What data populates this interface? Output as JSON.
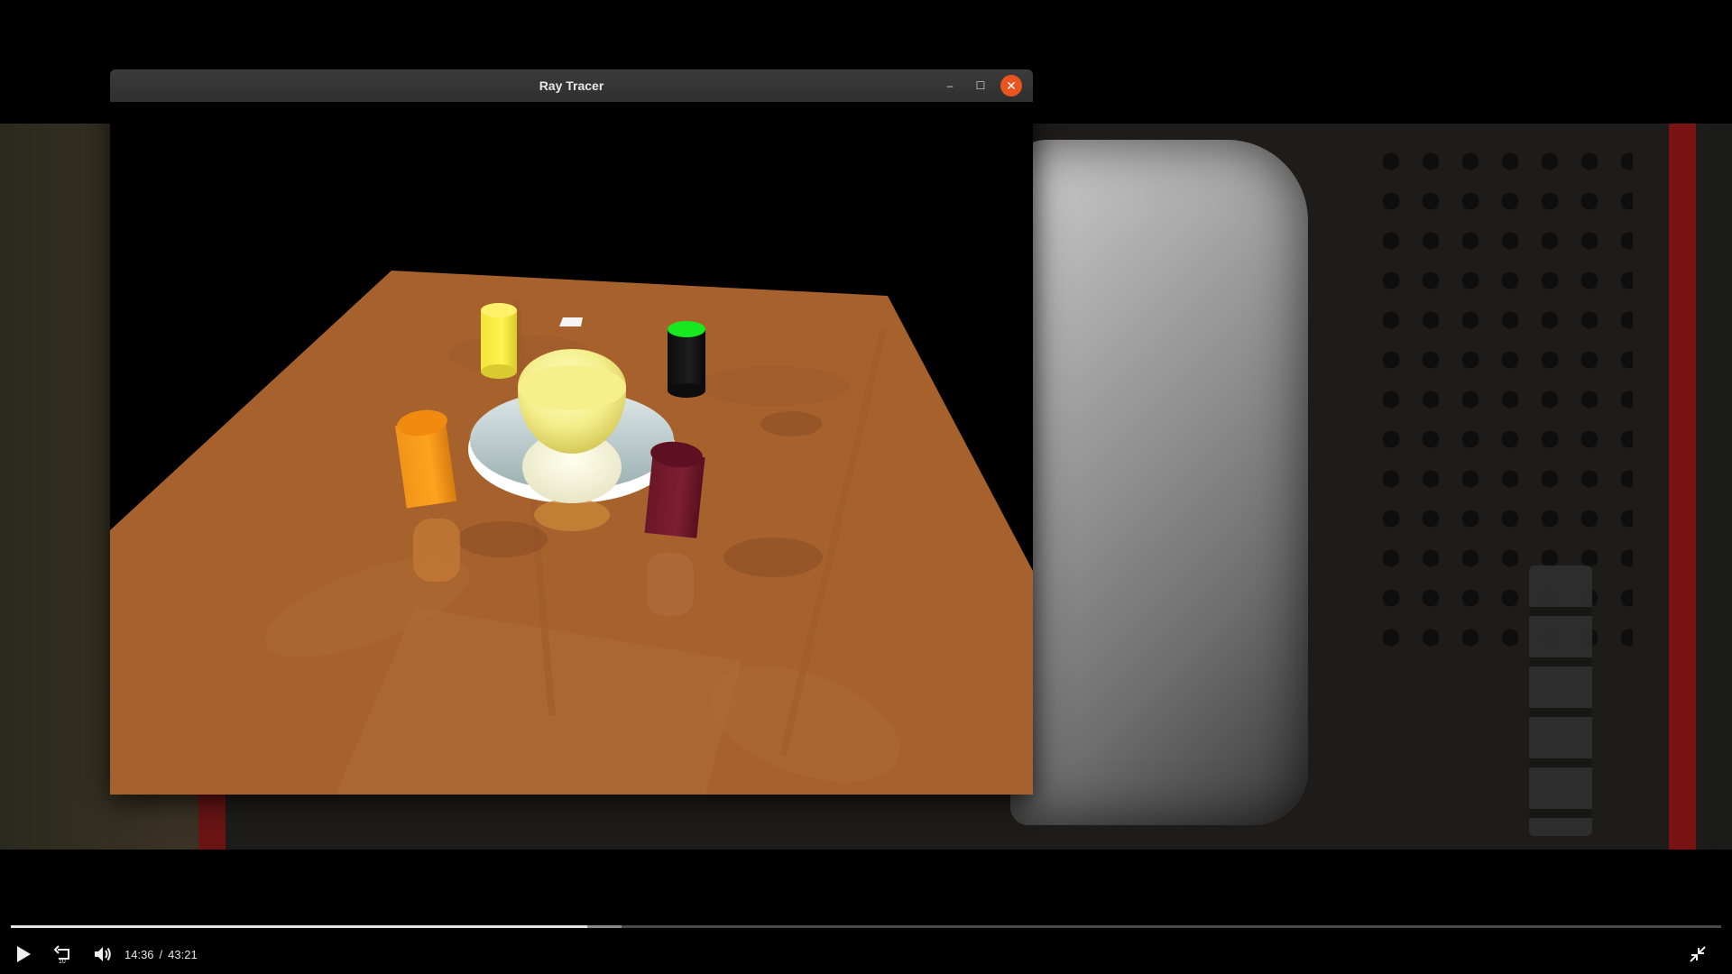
{
  "window": {
    "title": "Ray Tracer",
    "controls": {
      "minimize": "–",
      "maximize": "☐",
      "close": "✕"
    }
  },
  "player": {
    "current_time": "14:36",
    "separator": "/",
    "duration": "43:21",
    "progress": 0.337,
    "buffered": 0.357,
    "icons": [
      "play-icon",
      "replay-10-icon",
      "volume-icon",
      "fullscreen-exit-icon"
    ]
  },
  "colors": {
    "table": "#a6612d",
    "title_bar": "#2f2f2f",
    "close_button": "#e9541f",
    "progress_fill": "#e6e6e6"
  }
}
